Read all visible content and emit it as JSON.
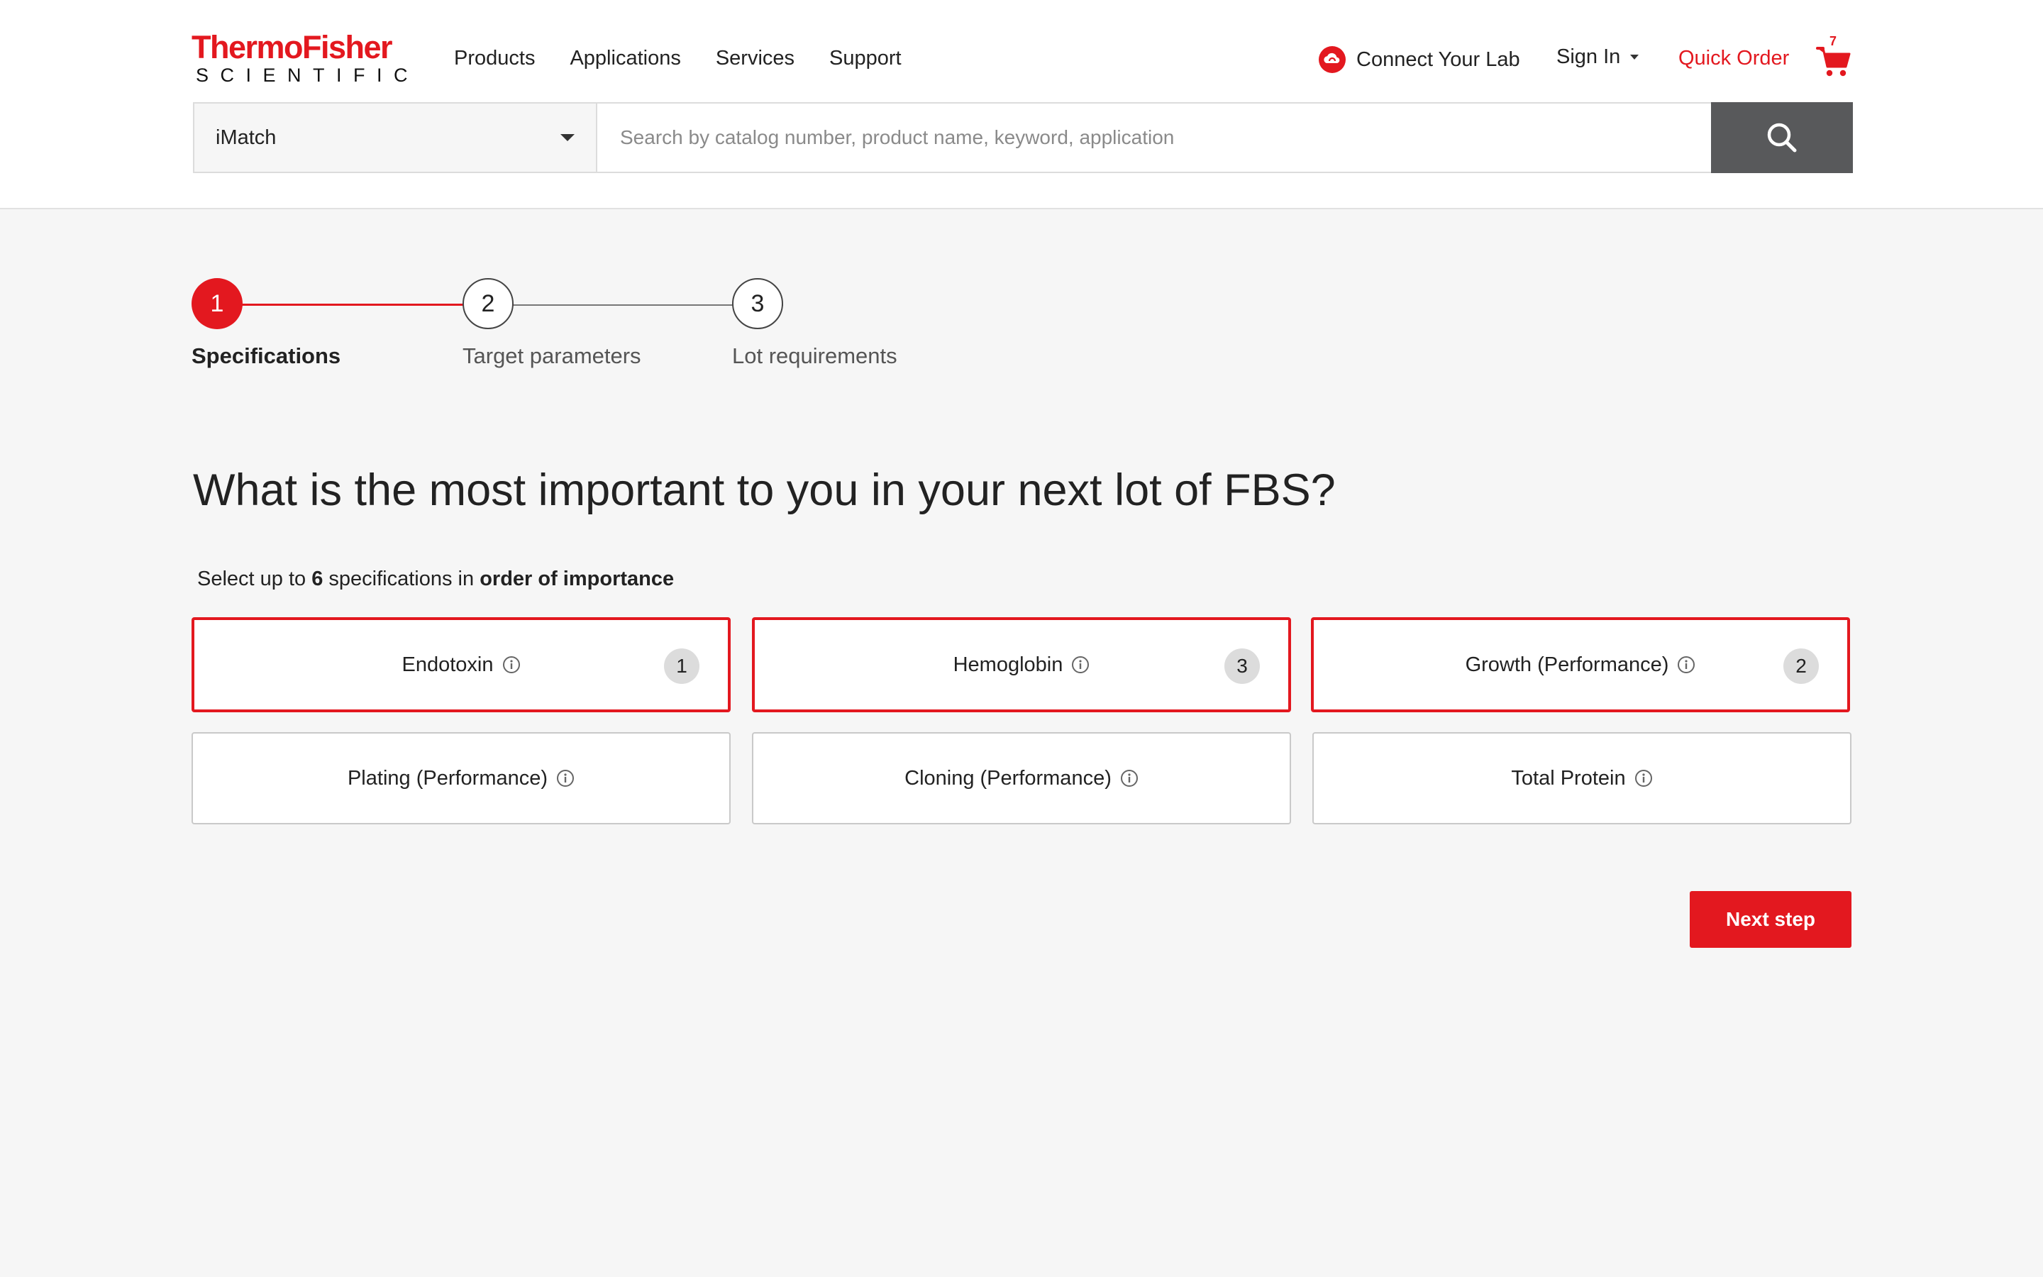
{
  "brand": {
    "logo_line1": "ThermoFisher",
    "logo_line2": "SCIENTIFIC",
    "accent_color": "#e3181f"
  },
  "nav": {
    "items": [
      "Products",
      "Applications",
      "Services",
      "Support"
    ]
  },
  "utility": {
    "connect_label": "Connect Your Lab",
    "signin_label": "Sign In",
    "quick_order_label": "Quick Order",
    "cart_count": "7",
    "icons": {
      "connect": "cloud-icon",
      "cart": "cart-icon",
      "search": "search-icon",
      "info": "info-icon"
    }
  },
  "search": {
    "category": "iMatch",
    "placeholder": "Search by catalog number, product name, keyword, application"
  },
  "stepper": {
    "current_step": 1,
    "steps": [
      {
        "number": "1",
        "label": "Specifications"
      },
      {
        "number": "2",
        "label": "Target parameters"
      },
      {
        "number": "3",
        "label": "Lot requirements"
      }
    ]
  },
  "main": {
    "question": "What is the most important to you in your next lot of FBS?",
    "instruction": {
      "prefix": "Select up to ",
      "count": "6",
      "middle": " specifications in ",
      "emphasis": "order of importance"
    },
    "options": [
      {
        "label": "Endotoxin",
        "selected": true,
        "rank": "1"
      },
      {
        "label": "Hemoglobin",
        "selected": true,
        "rank": "3"
      },
      {
        "label": "Growth (Performance)",
        "selected": true,
        "rank": "2"
      },
      {
        "label": "Plating (Performance)",
        "selected": false,
        "rank": ""
      },
      {
        "label": "Cloning (Performance)",
        "selected": false,
        "rank": ""
      },
      {
        "label": "Total Protein",
        "selected": false,
        "rank": ""
      }
    ],
    "next_label": "Next step"
  }
}
